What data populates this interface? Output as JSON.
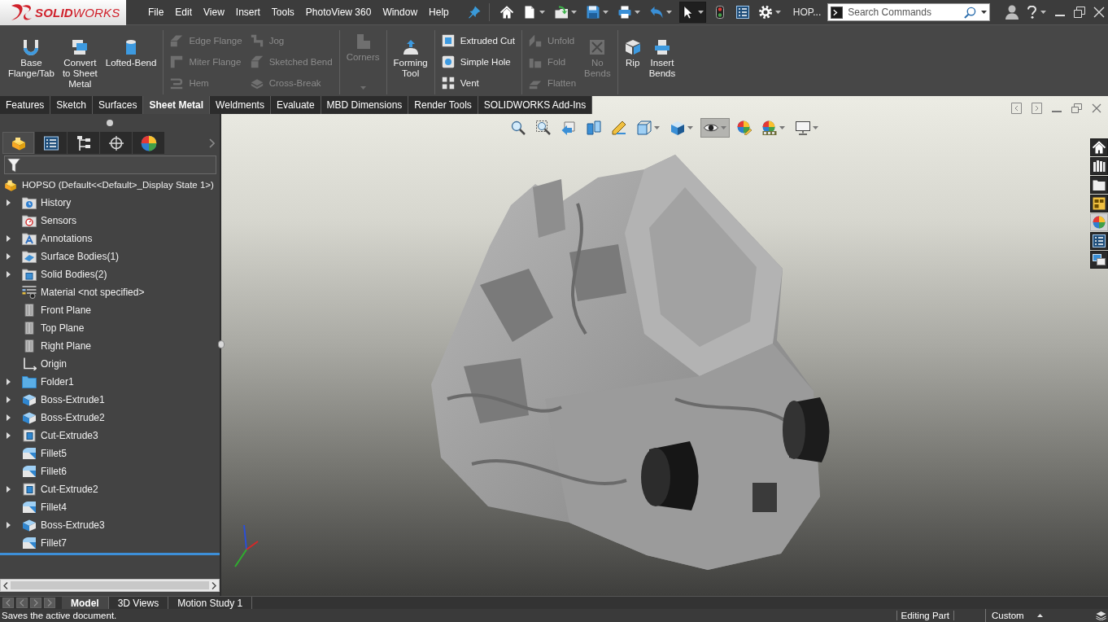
{
  "title_bar": {
    "logo": "**SOLID**WORKS",
    "menu": [
      "File",
      "Edit",
      "View",
      "Insert",
      "Tools",
      "PhotoView 360",
      "Window",
      "Help"
    ],
    "quick_access": [
      {
        "kind": "home",
        "dropdown": false,
        "pressed": false
      },
      {
        "kind": "new",
        "dropdown": true,
        "pressed": false
      },
      {
        "kind": "open",
        "dropdown": true,
        "pressed": false
      },
      {
        "kind": "save",
        "dropdown": true,
        "pressed": false
      },
      {
        "kind": "print",
        "dropdown": true,
        "pressed": false
      },
      {
        "kind": "undo",
        "dropdown": true,
        "pressed": false
      },
      {
        "kind": "select",
        "dropdown": true,
        "pressed": true
      },
      {
        "kind": "rebuild",
        "dropdown": false,
        "pressed": false
      },
      {
        "kind": "file-properties",
        "dropdown": false,
        "pressed": false
      },
      {
        "kind": "options",
        "dropdown": true,
        "pressed": false
      }
    ],
    "document": "HOP...",
    "search": {
      "placeholder": "Search Commands"
    }
  },
  "ribbon": [
    {
      "columns": [
        {
          "kind": "large",
          "items": [
            {
              "label": "Base\nFlange/Tab",
              "disabled": false
            }
          ]
        },
        {
          "kind": "large",
          "items": [
            {
              "label": "Convert\nto Sheet\nMetal",
              "disabled": false
            }
          ]
        },
        {
          "kind": "large",
          "items": [
            {
              "label": "Lofted-Bend",
              "disabled": false
            }
          ]
        }
      ]
    },
    {
      "columns": [
        {
          "kind": "stack",
          "items": [
            {
              "label": "Edge Flange",
              "disabled": true
            },
            {
              "label": "Miter Flange",
              "disabled": true
            },
            {
              "label": "Hem",
              "disabled": true
            }
          ]
        },
        {
          "kind": "stack",
          "items": [
            {
              "label": "Jog",
              "disabled": true
            },
            {
              "label": "Sketched Bend",
              "disabled": true
            },
            {
              "label": "Cross-Break",
              "disabled": true
            }
          ]
        }
      ]
    },
    {
      "columns": [
        {
          "kind": "large-menu",
          "items": [
            {
              "label": "Corners",
              "disabled": true
            }
          ]
        }
      ]
    },
    {
      "columns": [
        {
          "kind": "large",
          "items": [
            {
              "label": "Forming\nTool",
              "disabled": false
            }
          ]
        }
      ]
    },
    {
      "columns": [
        {
          "kind": "stack",
          "items": [
            {
              "label": "Extruded Cut",
              "disabled": false
            },
            {
              "label": "Simple Hole",
              "disabled": false
            },
            {
              "label": "Vent",
              "disabled": false
            }
          ]
        }
      ]
    },
    {
      "columns": [
        {
          "kind": "stack",
          "items": [
            {
              "label": "Unfold",
              "disabled": true
            },
            {
              "label": "Fold",
              "disabled": true
            },
            {
              "label": "Flatten",
              "disabled": true
            }
          ]
        },
        {
          "kind": "large",
          "items": [
            {
              "label": "No\nBends",
              "disabled": true
            }
          ]
        }
      ]
    },
    {
      "columns": [
        {
          "kind": "large",
          "items": [
            {
              "label": "Rip",
              "disabled": false
            }
          ]
        },
        {
          "kind": "large",
          "items": [
            {
              "label": "Insert\nBends",
              "disabled": false
            }
          ]
        }
      ]
    }
  ],
  "command_tabs": [
    {
      "label": "Features",
      "selected": false
    },
    {
      "label": "Sketch",
      "selected": false
    },
    {
      "label": "Surfaces",
      "selected": false
    },
    {
      "label": "Sheet Metal",
      "selected": true
    },
    {
      "label": "Weldments",
      "selected": false
    },
    {
      "label": "Evaluate",
      "selected": false
    },
    {
      "label": "MBD Dimensions",
      "selected": false
    },
    {
      "label": "Render Tools",
      "selected": false
    },
    {
      "label": "SOLIDWORKS Add-Ins",
      "selected": false
    }
  ],
  "feature_manager": {
    "panel_tabs": [
      {
        "kind": "feature-tree",
        "selected": true
      },
      {
        "kind": "property-manager",
        "selected": false
      },
      {
        "kind": "configuration",
        "selected": false
      },
      {
        "kind": "dimxpert",
        "selected": false
      },
      {
        "kind": "display",
        "selected": false
      }
    ],
    "root": "HOPSO (Default<<Default>_Display State 1>)",
    "items": [
      {
        "label": "History",
        "kind": "history",
        "expanded": false
      },
      {
        "label": "Sensors",
        "kind": "sensors"
      },
      {
        "label": "Annotations",
        "kind": "annotations",
        "expanded": false
      },
      {
        "label": "Surface Bodies(1)",
        "kind": "surface-bodies",
        "expanded": false
      },
      {
        "label": "Solid Bodies(2)",
        "kind": "solid-bodies",
        "expanded": false
      },
      {
        "label": "Material <not specified>",
        "kind": "material"
      },
      {
        "label": "Front Plane",
        "kind": "plane"
      },
      {
        "label": "Top Plane",
        "kind": "plane"
      },
      {
        "label": "Right Plane",
        "kind": "plane"
      },
      {
        "label": "Origin",
        "kind": "origin"
      },
      {
        "label": "Folder1",
        "kind": "folder",
        "expanded": false
      },
      {
        "label": "Boss-Extrude1",
        "kind": "boss-extrude",
        "expanded": false
      },
      {
        "label": "Boss-Extrude2",
        "kind": "boss-extrude",
        "expanded": false
      },
      {
        "label": "Cut-Extrude3",
        "kind": "cut-extrude",
        "expanded": false
      },
      {
        "label": "Fillet5",
        "kind": "fillet"
      },
      {
        "label": "Fillet6",
        "kind": "fillet"
      },
      {
        "label": "Cut-Extrude2",
        "kind": "cut-extrude",
        "expanded": false
      },
      {
        "label": "Fillet4",
        "kind": "fillet"
      },
      {
        "label": "Boss-Extrude3",
        "kind": "boss-extrude",
        "expanded": false
      },
      {
        "label": "Fillet7",
        "kind": "fillet"
      }
    ]
  },
  "heads_up_toolbar": [
    {
      "kind": "zoom-fit",
      "dropdown": false,
      "pressed": false
    },
    {
      "kind": "zoom-area",
      "dropdown": false,
      "pressed": false
    },
    {
      "kind": "previous-view",
      "dropdown": false,
      "pressed": false
    },
    {
      "kind": "section-view",
      "dropdown": false,
      "pressed": false
    },
    {
      "kind": "annotation-views",
      "dropdown": false,
      "pressed": false
    },
    {
      "kind": "view-orientation",
      "dropdown": true,
      "pressed": false
    },
    {
      "kind": "display-style",
      "dropdown": true,
      "pressed": false
    },
    {
      "kind": "hide-show",
      "dropdown": true,
      "pressed": true
    },
    {
      "kind": "edit-appearance",
      "dropdown": false,
      "pressed": false
    },
    {
      "kind": "apply-scene",
      "dropdown": true,
      "pressed": false
    },
    {
      "kind": "view-settings",
      "dropdown": true,
      "pressed": false
    }
  ],
  "task_pane": [
    {
      "kind": "home",
      "selected": false
    },
    {
      "kind": "library",
      "selected": false
    },
    {
      "kind": "explorer",
      "selected": false
    },
    {
      "kind": "view-palette",
      "selected": false
    },
    {
      "kind": "appearances",
      "selected": true
    },
    {
      "kind": "properties",
      "selected": false
    },
    {
      "kind": "windows",
      "selected": false
    }
  ],
  "bottom_tabs": [
    {
      "label": "Model",
      "selected": true
    },
    {
      "label": "3D Views",
      "selected": false
    },
    {
      "label": "Motion Study 1",
      "selected": false
    }
  ],
  "status_bar": {
    "message": "Saves the active document.",
    "mode": "Editing Part",
    "units": "Custom"
  }
}
